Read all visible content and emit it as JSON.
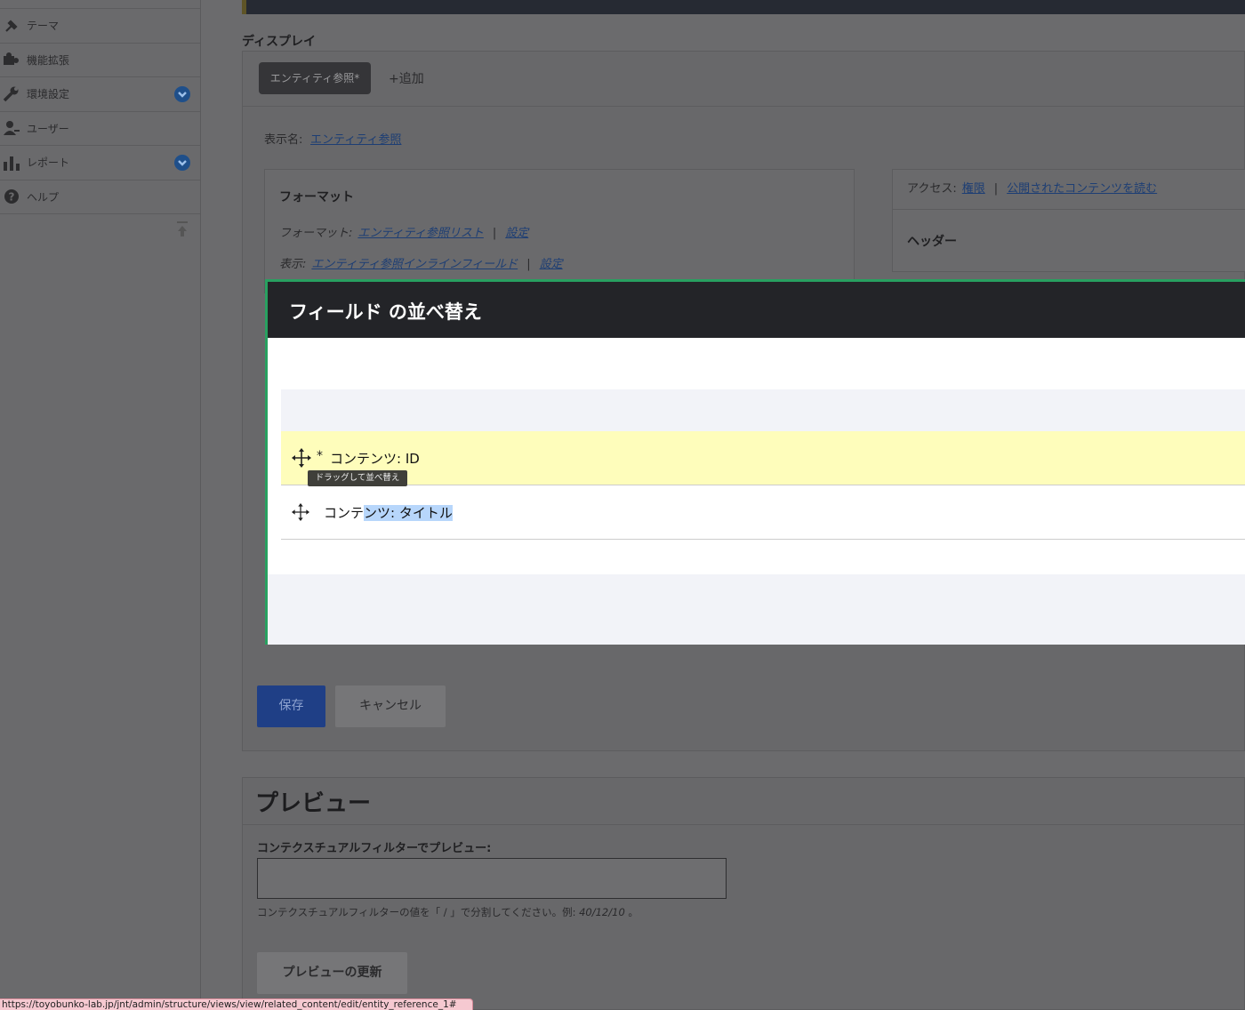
{
  "sidebar": {
    "items": [
      {
        "label": "テーマ",
        "icon": "paintbrush-icon",
        "has_chevron": false
      },
      {
        "label": "機能拡張",
        "icon": "puzzle-icon",
        "has_chevron": false
      },
      {
        "label": "環境設定",
        "icon": "wrench-icon",
        "has_chevron": true
      },
      {
        "label": "ユーザー",
        "icon": "user-icon",
        "has_chevron": false
      },
      {
        "label": "レポート",
        "icon": "bar-chart-icon",
        "has_chevron": true
      },
      {
        "label": "ヘルプ",
        "icon": "help-icon",
        "has_chevron": false
      }
    ]
  },
  "display": {
    "section_title": "ディスプレイ",
    "active_tab": "エンティティ参照*",
    "add_tab": "+追加",
    "display_name_label": "表示名:",
    "display_name_value": "エンティティ参照",
    "format_box": {
      "title": "フォーマット",
      "format_label": "フォーマット:",
      "format_value": "エンティティ参照リスト",
      "format_settings": "設定",
      "show_label": "表示:",
      "show_value": "エンティティ参照インラインフィールド",
      "show_settings": "設定",
      "separator": "|"
    },
    "right_box": {
      "access_label": "アクセス:",
      "access_value": "権限",
      "access_perm": "公開されたコンテンツを読む",
      "header_title": "ヘッダー"
    },
    "save_label": "保存",
    "cancel_label": "キャンセル"
  },
  "modal": {
    "title": "フィールド の並べ替え",
    "rows": [
      {
        "changed_marker": "*",
        "label": "コンテンツ: ID"
      },
      {
        "label_prefix": "コンテ",
        "label_selected": "ンツ: タイトル"
      }
    ],
    "tooltip": "ドラッグして並べ替え"
  },
  "preview": {
    "title": "プレビュー",
    "field_label": "コンテクスチュアルフィルターでプレビュー:",
    "input_value": "",
    "help_prefix": "コンテクスチュアルフィルターの値を「 / 」で分割してください。例: ",
    "help_example": "40/12/10",
    "help_suffix": " 。",
    "update_button": "プレビューの更新"
  },
  "status_bar": {
    "url": "https://toyobunko-lab.jp/jnt/admin/structure/views/view/related_content/edit/entity_reference_1#"
  },
  "colors": {
    "modal_border": "#28a060",
    "row_changed_bg": "#fefdbb",
    "selection": "#b7d6fb",
    "save_button": "#1f3f86"
  }
}
